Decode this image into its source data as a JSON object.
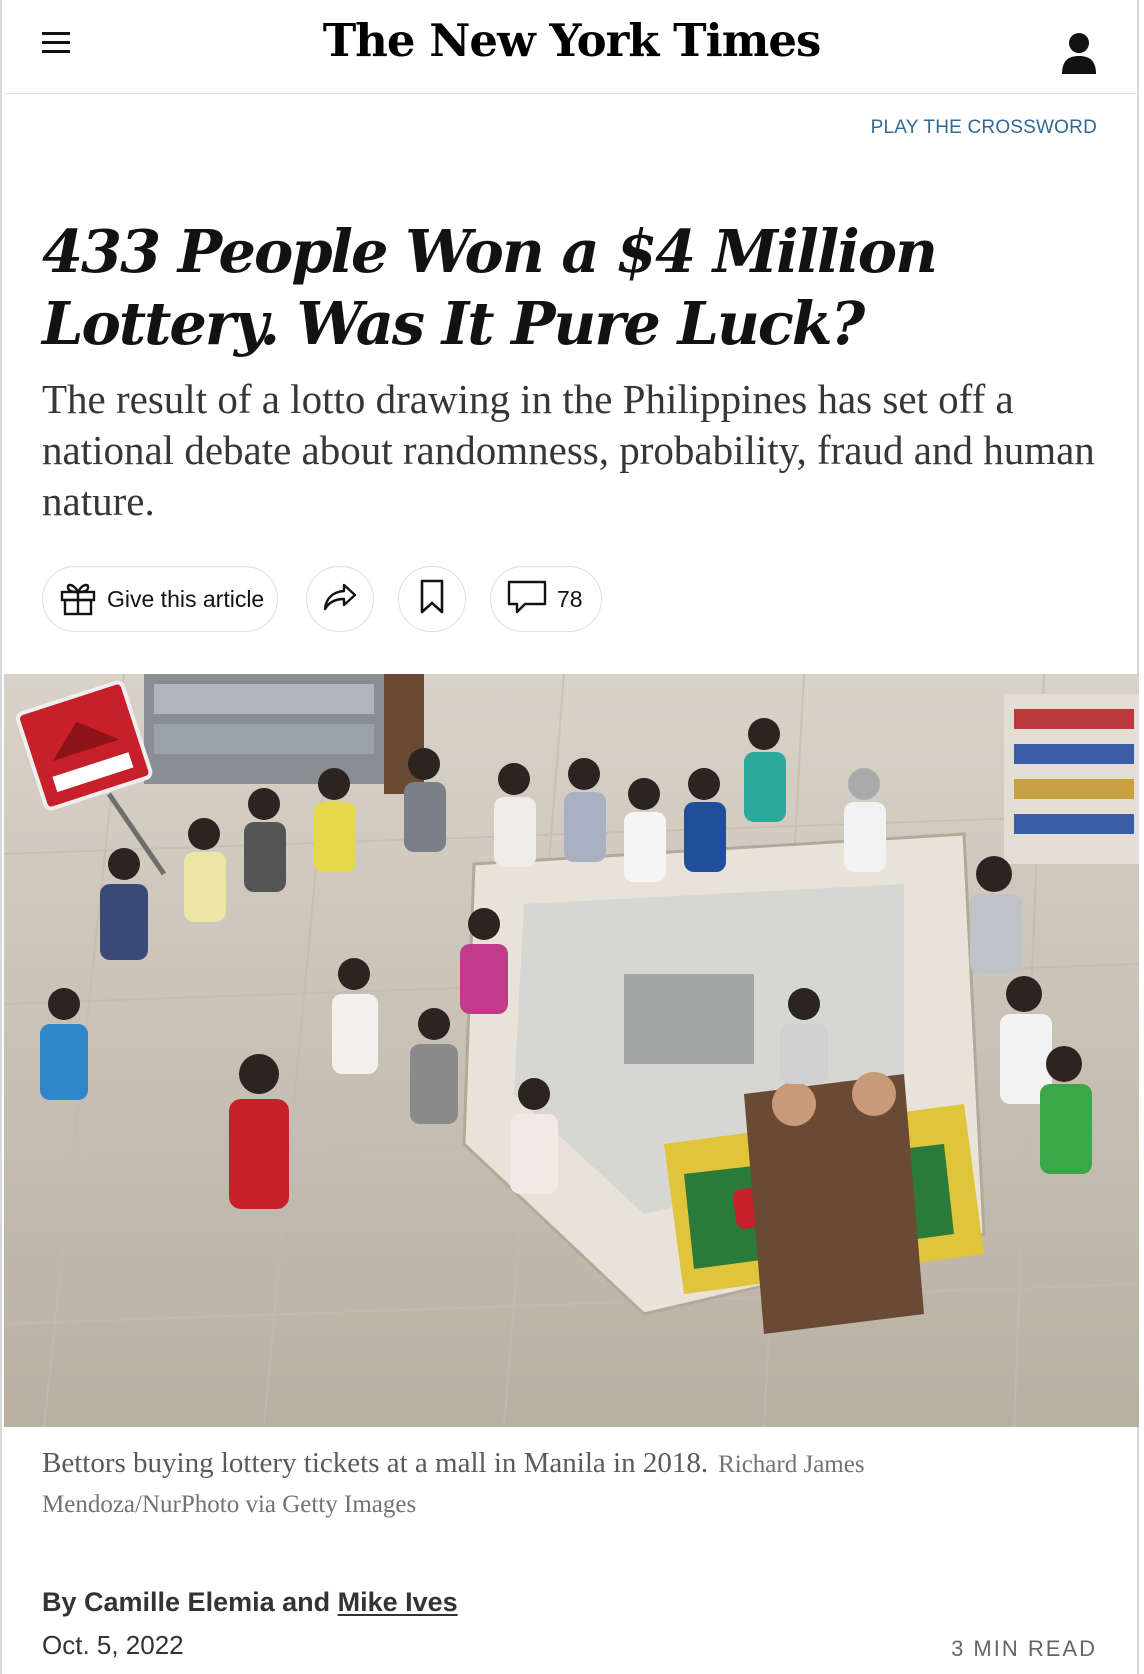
{
  "header": {
    "logo": "The New York Times",
    "menu_icon": "hamburger-menu-icon",
    "account_icon": "person-icon"
  },
  "top_link": "PLAY THE CROSSWORD",
  "article": {
    "headline": "433 People Won a $4 Million Lottery. Was It Pure Luck?",
    "summary": "The result of a lotto drawing in the Philippines has set off a national debate about randomness, probability, fraud and human nature.",
    "actions": {
      "gift_label": "Give this article",
      "gift_icon": "gift-icon",
      "share_icon": "share-arrow-icon",
      "save_icon": "bookmark-icon",
      "comments_icon": "comment-bubble-icon",
      "comments_count": "78"
    },
    "caption": {
      "text": "Bettors buying lottery tickets at a mall in Manila in 2018.",
      "credit": "Richard James Mendoza/NurPhoto via Getty Images"
    },
    "byline": {
      "prefix": "By Camille Elemia and ",
      "linked_author": "Mike Ives"
    },
    "date": "Oct. 5, 2022",
    "read_time": "3 MIN READ"
  },
  "colors": {
    "link": "#326891",
    "text": "#121212",
    "accent_red": "#c8202b"
  }
}
